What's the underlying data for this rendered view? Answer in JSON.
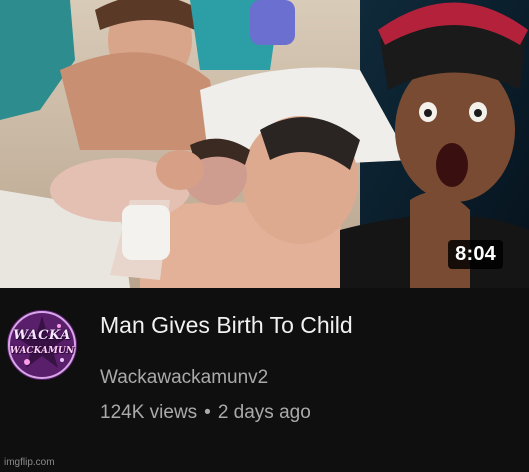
{
  "video": {
    "title": "Man Gives Birth To Child",
    "duration": "8:04",
    "thumbnail_icon": "video-thumbnail"
  },
  "channel": {
    "name": "Wackawackamunv2",
    "avatar_text_top": "WACKA",
    "avatar_text_bottom": "WACKAMUN",
    "avatar_icon": "channel-avatar"
  },
  "stats": {
    "views": "124K views",
    "separator": "•",
    "age": "2 days ago"
  },
  "watermark": "imgflip.com",
  "colors": {
    "background": "#0f0f0f",
    "title": "#f1f1f1",
    "secondary_text": "#aaaaaa",
    "duration_badge": "#000000"
  }
}
